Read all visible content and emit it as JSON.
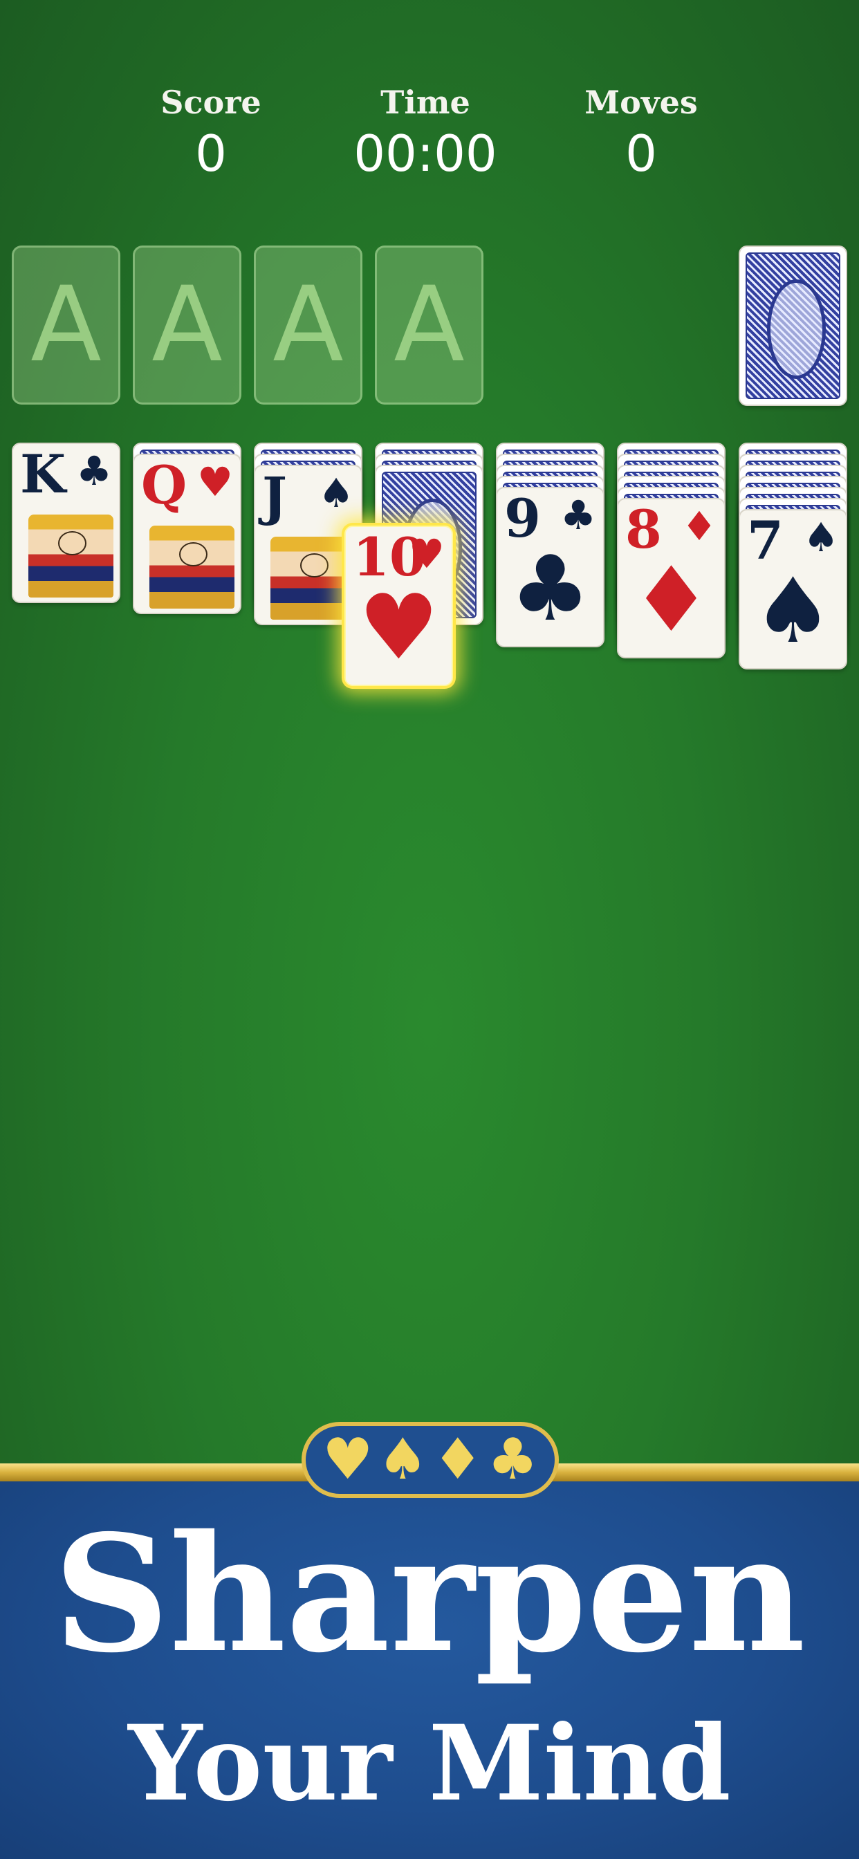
{
  "stats": {
    "score": {
      "label": "Score",
      "value": "0"
    },
    "time": {
      "label": "Time",
      "value": "00:00"
    },
    "moves": {
      "label": "Moves",
      "value": "0"
    }
  },
  "foundations": [
    "A",
    "A",
    "A",
    "A"
  ],
  "stock": {
    "icon": "card-back-icon"
  },
  "tableau": [
    {
      "face_down": 0,
      "top": {
        "rank": "K",
        "suit": "♣",
        "color": "black",
        "face_card": true
      }
    },
    {
      "face_down": 1,
      "top": {
        "rank": "Q",
        "suit": "♥",
        "color": "red",
        "face_card": true
      }
    },
    {
      "face_down": 2,
      "top": {
        "rank": "J",
        "suit": "♠",
        "color": "black",
        "face_card": true
      }
    },
    {
      "face_down": 3,
      "top": {
        "rank": "10",
        "suit": "♥",
        "color": "red",
        "face_card": false,
        "highlighted": true
      }
    },
    {
      "face_down": 4,
      "top": {
        "rank": "9",
        "suit": "♣",
        "color": "black",
        "face_card": false
      }
    },
    {
      "face_down": 5,
      "top": {
        "rank": "8",
        "suit": "♦",
        "color": "red",
        "face_card": false
      }
    },
    {
      "face_down": 6,
      "top": {
        "rank": "7",
        "suit": "♠",
        "color": "black",
        "face_card": false
      }
    }
  ],
  "colors": {
    "felt": "#257a2a",
    "banner": "#1e4d8e",
    "gold": "#d9b23e",
    "highlight": "#ffe74a",
    "red_suit": "#cf2027",
    "black_suit": "#0f2140"
  },
  "banner": {
    "suits": [
      "♥",
      "♠",
      "♦",
      "♣"
    ],
    "line1": "Sharpen",
    "line2": "Your Mind"
  }
}
